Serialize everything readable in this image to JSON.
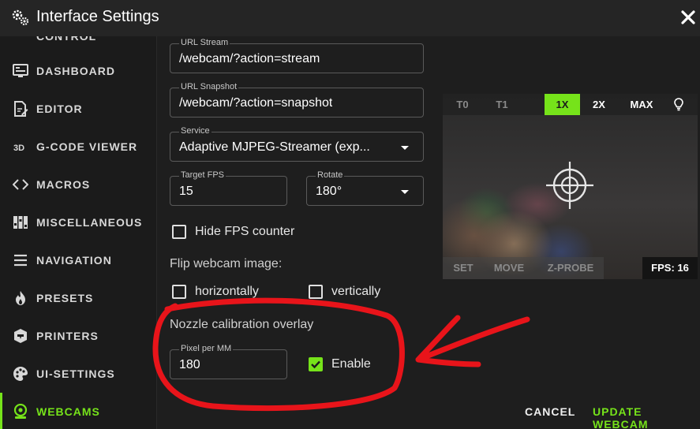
{
  "titlebar": {
    "title": "Interface Settings",
    "settings_icon": "gears-icon",
    "close_icon": "close-icon"
  },
  "sidebar": {
    "partial_item": "CONTROL",
    "items": [
      {
        "label": "DASHBOARD",
        "icon": "dashboard-icon"
      },
      {
        "label": "EDITOR",
        "icon": "edit-file-icon"
      },
      {
        "label": "G-CODE VIEWER",
        "icon": "3d-icon"
      },
      {
        "label": "MACROS",
        "icon": "code-icon"
      },
      {
        "label": "MISCELLANEOUS",
        "icon": "sliders-icon"
      },
      {
        "label": "NAVIGATION",
        "icon": "menu-icon"
      },
      {
        "label": "PRESETS",
        "icon": "fire-icon"
      },
      {
        "label": "PRINTERS",
        "icon": "printer-icon"
      },
      {
        "label": "UI-SETTINGS",
        "icon": "palette-icon"
      },
      {
        "label": "WEBCAMS",
        "icon": "webcam-icon",
        "active": true
      }
    ],
    "active_color": "#76e31a"
  },
  "form": {
    "url_stream": {
      "label": "URL Stream",
      "value": "/webcam/?action=stream"
    },
    "url_snapshot": {
      "label": "URL Snapshot",
      "value": "/webcam/?action=snapshot"
    },
    "service": {
      "label": "Service",
      "value": "Adaptive MJPEG-Streamer (exp..."
    },
    "target_fps": {
      "label": "Target FPS",
      "value": "15"
    },
    "rotate": {
      "label": "Rotate",
      "value": "180°"
    },
    "hide_fps": {
      "label": "Hide FPS counter",
      "checked": false
    },
    "flip_label": "Flip webcam image:",
    "flip_horizontal": {
      "label": "horizontally",
      "checked": false
    },
    "flip_vertical": {
      "label": "vertically",
      "checked": false
    },
    "nozzle_label": "Nozzle calibration overlay",
    "pixel_per_mm": {
      "label": "Pixel per MM",
      "value": "180"
    },
    "enable": {
      "label": "Enable",
      "checked": true
    }
  },
  "preview": {
    "top_buttons": [
      "T0",
      "T1",
      "1X",
      "2X",
      "MAX"
    ],
    "selected_zoom": "1X",
    "light_icon": "lightbulb-icon",
    "bottom_buttons": [
      "SET",
      "MOVE",
      "Z-PROBE"
    ],
    "fps_text": "FPS: 16",
    "crosshair_icon": "crosshair-icon"
  },
  "footer": {
    "cancel_label": "CANCEL",
    "update_label": "UPDATE WEBCAM"
  },
  "colors": {
    "accent": "#76e31a",
    "annotation": "#e8141a"
  }
}
